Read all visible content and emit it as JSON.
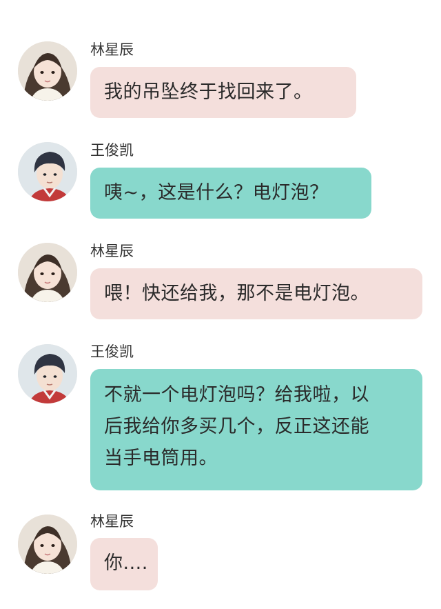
{
  "colors": {
    "pink_bubble": "#f4dfdc",
    "teal_bubble": "#88d8cc"
  },
  "messages": [
    {
      "sender": "林星辰",
      "avatar": "girl-avatar",
      "lines": [
        "我的吊坠终于找回来了。"
      ]
    },
    {
      "sender": "王俊凯",
      "avatar": "boy-avatar",
      "lines": [
        "咦~，这是什么？电灯泡？"
      ]
    },
    {
      "sender": "林星辰",
      "avatar": "girl-avatar",
      "lines": [
        "喂！快还给我，那不是电灯泡。"
      ]
    },
    {
      "sender": "王俊凯",
      "avatar": "boy-avatar",
      "lines": [
        "不就一个电灯泡吗？给我啦，以",
        "后我给你多买几个，反正这还能",
        "当手电筒用。"
      ]
    },
    {
      "sender": "林星辰",
      "avatar": "girl-avatar",
      "lines": [
        "你...."
      ]
    }
  ]
}
